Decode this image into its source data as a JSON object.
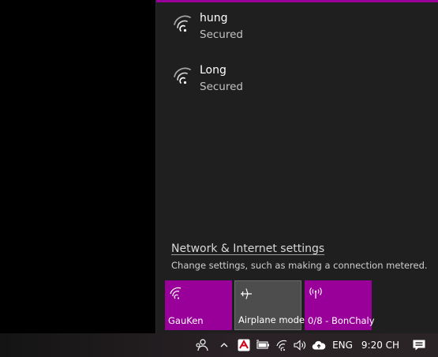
{
  "colors": {
    "accent": "#990099",
    "flyout_bg": "#1f1f1f",
    "tile_off": "#4d4d4d"
  },
  "networks": [
    {
      "ssid": "hung",
      "status": "Secured",
      "icon": "wifi-icon"
    },
    {
      "ssid": "Long",
      "status": "Secured",
      "icon": "wifi-icon"
    }
  ],
  "settings": {
    "link": "Network & Internet settings",
    "hint": "Change settings, such as making a connection metered."
  },
  "quick_actions": [
    {
      "label": "GauKen",
      "icon": "wifi-icon",
      "state": "on"
    },
    {
      "label": "Airplane mode",
      "icon": "airplane-icon",
      "state": "off"
    },
    {
      "label": "0/8 - BonChaly",
      "icon": "mobile-hotspot-icon",
      "state": "on"
    }
  ],
  "taskbar": {
    "icons": [
      "people-icon",
      "chevron-up-icon",
      "antivirus-icon",
      "battery-icon",
      "wifi-icon",
      "volume-icon",
      "cloud-upload-icon"
    ],
    "language": "ENG",
    "clock": "9:20 CH",
    "notification_icon": "action-center-icon"
  }
}
